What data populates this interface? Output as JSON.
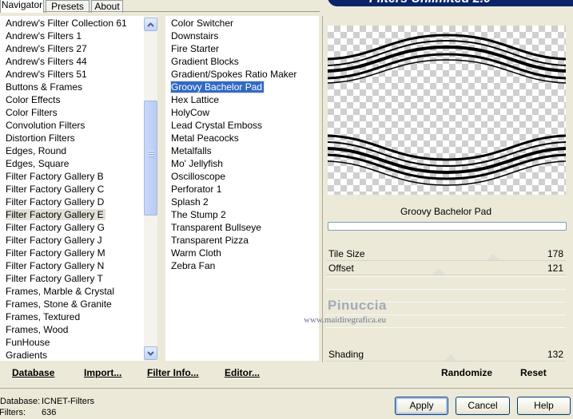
{
  "tabs": [
    {
      "label": "Navigator",
      "active": true
    },
    {
      "label": "Presets",
      "active": false
    },
    {
      "label": "About",
      "active": false
    }
  ],
  "banner_text": "Filters Unlimited 2.0",
  "categories": [
    "Andrew's Filter Collection 61",
    "Andrew's Filters 1",
    "Andrew's Filters 27",
    "Andrew's Filters 44",
    "Andrew's Filters 51",
    "Buttons & Frames",
    "Color Effects",
    "Color Filters",
    "Convolution Filters",
    "Distortion Filters",
    "Edges, Round",
    "Edges, Square",
    "Filter Factory Gallery B",
    "Filter Factory Gallery C",
    "Filter Factory Gallery D",
    "Filter Factory Gallery E",
    "Filter Factory Gallery G",
    "Filter Factory Gallery J",
    "Filter Factory Gallery M",
    "Filter Factory Gallery N",
    "Filter Factory Gallery T",
    "Frames, Marble & Crystal",
    "Frames, Stone & Granite",
    "Frames, Textured",
    "Frames, Wood",
    "FunHouse",
    "Gradients"
  ],
  "selected_category": "Filter Factory Gallery E",
  "filters": [
    "Color Switcher",
    "Downstairs",
    "Fire Starter",
    "Gradient Blocks",
    "Gradient/Spokes Ratio Maker",
    "Groovy Bachelor Pad",
    "Hex Lattice",
    "HolyCow",
    "Lead Crystal Emboss",
    "Metal Peacocks",
    "Metalfalls",
    "Mo' Jellyfish",
    "Oscilloscope",
    "Perforator 1",
    "Splash 2",
    "The Stump 2",
    "Transparent Bullseye",
    "Transparent Pizza",
    "Warm Cloth",
    "Zebra Fan"
  ],
  "selected_filter": "Groovy Bachelor Pad",
  "filter_name_display": "Groovy Bachelor Pad",
  "params": {
    "tile_size": {
      "label": "Tile Size",
      "value": "178"
    },
    "offset": {
      "label": "Offset",
      "value": "121"
    },
    "shading": {
      "label": "Shading",
      "value": "132"
    }
  },
  "watermark": {
    "name": "Pinuccia",
    "url": "www.maidiregrafica.eu"
  },
  "links": {
    "database": "Database",
    "import": "Import...",
    "filter_info": "Filter Info...",
    "editor": "Editor...",
    "randomize": "Randomize",
    "reset": "Reset"
  },
  "status": {
    "database_label": "Database:",
    "database_value": "ICNET-Filters",
    "filters_label": "Filters:",
    "filters_value": "636"
  },
  "buttons": {
    "apply": "Apply",
    "cancel": "Cancel",
    "help": "Help"
  },
  "colors": {
    "selection": "#316ac5",
    "dialog_bg": "#ece9d8",
    "banner": "#0a246a"
  }
}
